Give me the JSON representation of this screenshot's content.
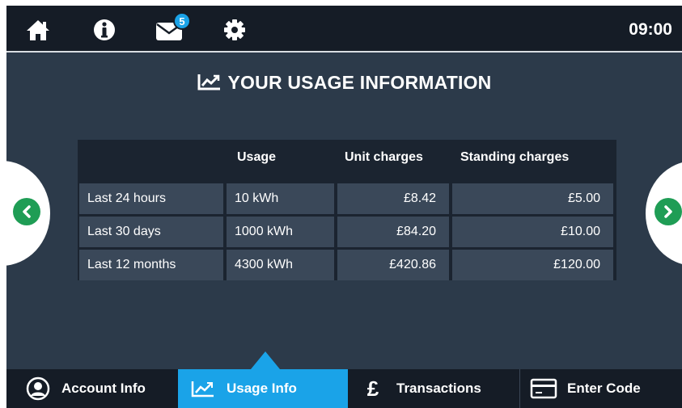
{
  "header": {
    "icons": [
      "home-icon",
      "info-icon",
      "mail-icon",
      "gear-icon"
    ],
    "mail_badge": "5",
    "clock": "09:00"
  },
  "page": {
    "title": "YOUR USAGE INFORMATION",
    "title_icon": "trend-chart-icon"
  },
  "usage_table": {
    "headers": [
      "",
      "Usage",
      "Unit charges",
      "Standing charges"
    ],
    "rows": [
      [
        "Last 24 hours",
        "10 kWh",
        "£8.42",
        "£5.00"
      ],
      [
        "Last 30 days",
        "1000 kWh",
        "£84.20",
        "£10.00"
      ],
      [
        "Last 12 months",
        "4300 kWh",
        "£420.86",
        "£120.00"
      ]
    ]
  },
  "nav": {
    "prev_icon": "chevron-left-icon",
    "next_icon": "chevron-right-icon"
  },
  "bottom_tabs": [
    {
      "label": "Account Info",
      "icon": "user-icon",
      "active": false
    },
    {
      "label": "Usage Info",
      "icon": "trend-chart-icon",
      "active": true
    },
    {
      "label": "Transactions",
      "icon": "pound-icon",
      "active": false
    },
    {
      "label": "Enter Code",
      "icon": "card-icon",
      "active": false
    }
  ],
  "colors": {
    "background": "#2c3a4a",
    "bar": "#151c26",
    "accent": "#1aa3e8",
    "arrow_green": "#1f9d55",
    "cell": "#3a4859"
  }
}
